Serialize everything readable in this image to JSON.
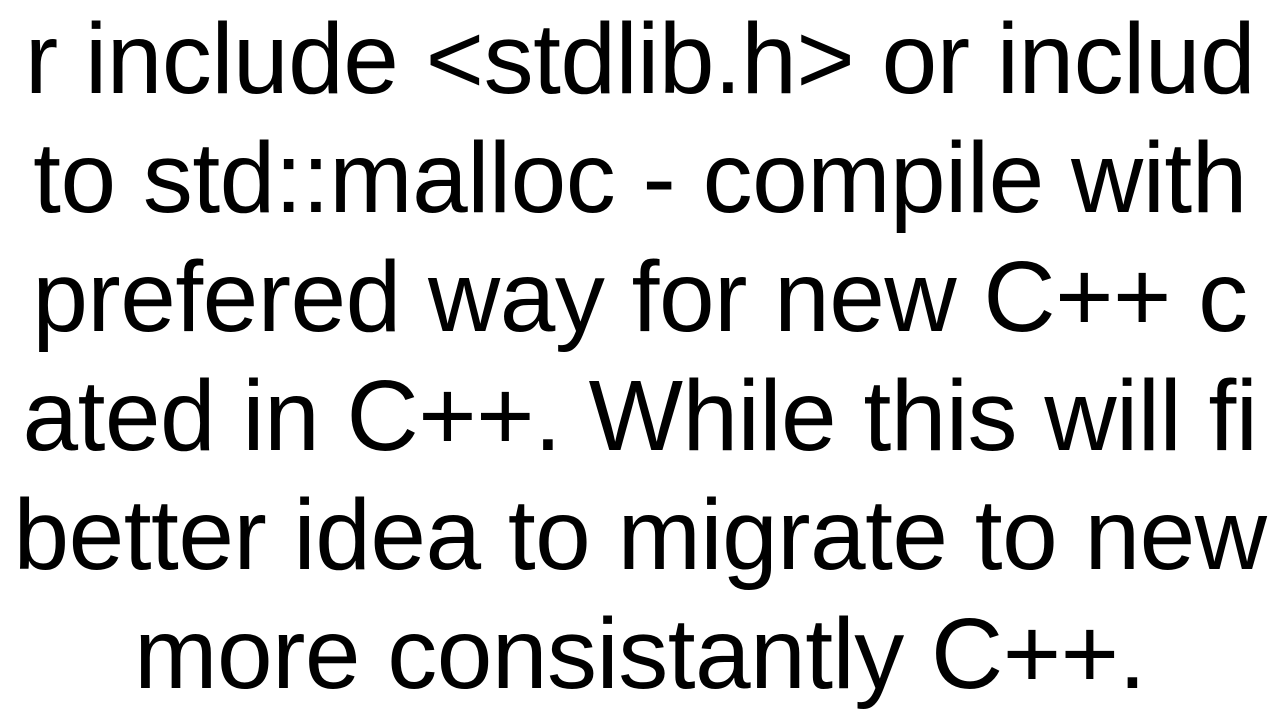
{
  "text": {
    "line1": "r include <stdlib.h> or includ",
    "line2": "to std::malloc - compile with",
    "line3": " prefered way for new C++ c",
    "line4": "ated in C++. While this will fi",
    "line5": "better idea to migrate to new",
    "line6": "more consistantly C++."
  }
}
